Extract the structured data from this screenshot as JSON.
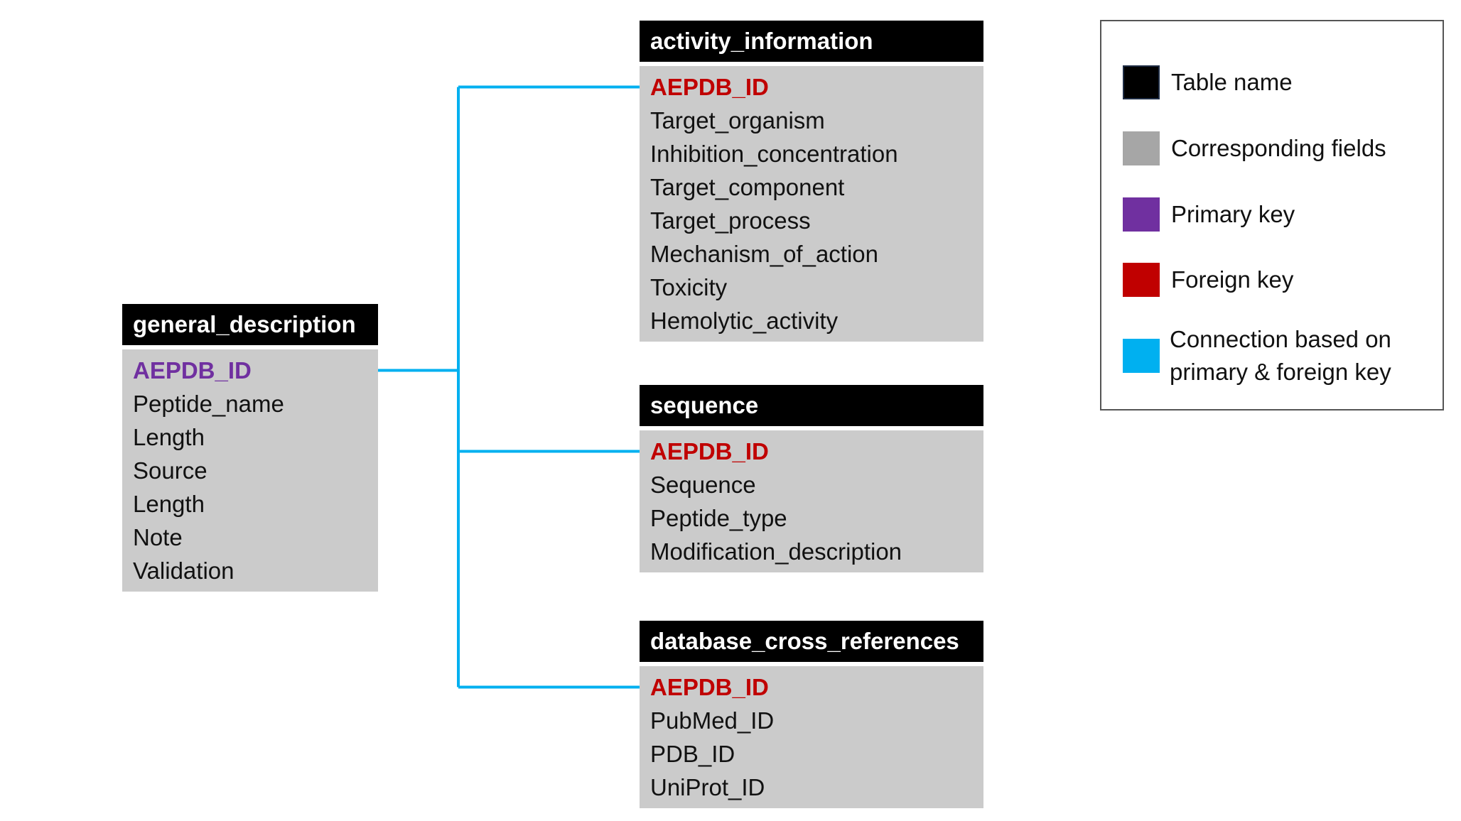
{
  "colors": {
    "table_header": "#000000",
    "fields_bg": "#cbcbcb",
    "primary_key": "#7030a0",
    "foreign_key": "#c00000",
    "connection": "#00b0f0"
  },
  "tables": {
    "general_description": {
      "name": "general_description",
      "fields": [
        {
          "label": "AEPDB_ID",
          "kind": "primary"
        },
        {
          "label": "Peptide_name",
          "kind": "normal"
        },
        {
          "label": "Length",
          "kind": "normal"
        },
        {
          "label": "Source",
          "kind": "normal"
        },
        {
          "label": "Length",
          "kind": "normal"
        },
        {
          "label": "Note",
          "kind": "normal"
        },
        {
          "label": "Validation",
          "kind": "normal"
        }
      ]
    },
    "activity_information": {
      "name": "activity_information",
      "fields": [
        {
          "label": "AEPDB_ID",
          "kind": "foreign"
        },
        {
          "label": "Target_organism",
          "kind": "normal"
        },
        {
          "label": "Inhibition_concentration",
          "kind": "normal"
        },
        {
          "label": "Target_component",
          "kind": "normal"
        },
        {
          "label": "Target_process",
          "kind": "normal"
        },
        {
          "label": "Mechanism_of_action",
          "kind": "normal"
        },
        {
          "label": "Toxicity",
          "kind": "normal"
        },
        {
          "label": "Hemolytic_activity",
          "kind": "normal"
        }
      ]
    },
    "sequence": {
      "name": "sequence",
      "fields": [
        {
          "label": "AEPDB_ID",
          "kind": "foreign"
        },
        {
          "label": "Sequence",
          "kind": "normal"
        },
        {
          "label": "Peptide_type",
          "kind": "normal"
        },
        {
          "label": "Modification_description",
          "kind": "normal"
        }
      ]
    },
    "database_cross_references": {
      "name": "database_cross_references",
      "fields": [
        {
          "label": "AEPDB_ID",
          "kind": "foreign"
        },
        {
          "label": "PubMed_ID",
          "kind": "normal"
        },
        {
          "label": "PDB_ID",
          "kind": "normal"
        },
        {
          "label": "UniProt_ID",
          "kind": "normal"
        }
      ]
    }
  },
  "connections": [
    {
      "from": "general_description.AEPDB_ID",
      "to": "activity_information.AEPDB_ID"
    },
    {
      "from": "general_description.AEPDB_ID",
      "to": "sequence.AEPDB_ID"
    },
    {
      "from": "general_description.AEPDB_ID",
      "to": "database_cross_references.AEPDB_ID"
    }
  ],
  "legend": {
    "items": [
      {
        "label": "Table name",
        "color": "#000000"
      },
      {
        "label": "Corresponding fields",
        "color": "#a6a6a6"
      },
      {
        "label": "Primary key",
        "color": "#7030a0"
      },
      {
        "label": "Foreign key",
        "color": "#c00000"
      },
      {
        "label": "Connection based on primary & foreign key",
        "line1": "Connection based on",
        "line2": "primary & foreign key",
        "color": "#00b0f0"
      }
    ]
  }
}
